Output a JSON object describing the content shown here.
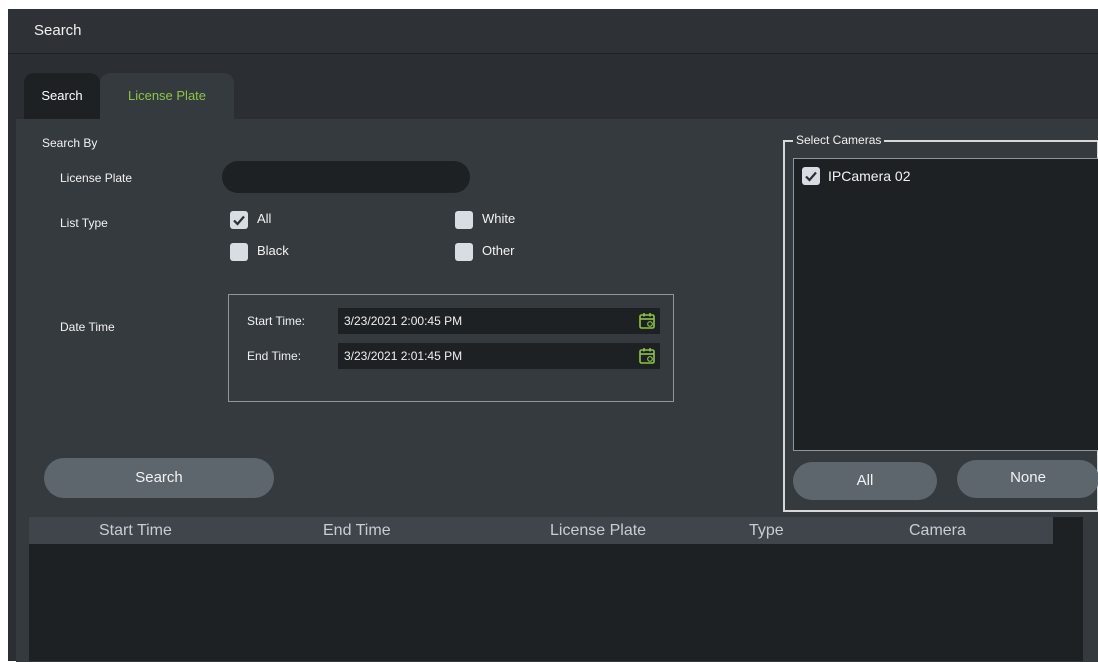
{
  "window": {
    "title": "Search"
  },
  "tabs": [
    {
      "label": "Search"
    },
    {
      "label": "License Plate"
    }
  ],
  "search_by": {
    "heading": "Search By",
    "license_plate_label": "License Plate",
    "license_plate_value": "",
    "list_type_label": "List Type",
    "list_types": [
      {
        "label": "All",
        "checked": true
      },
      {
        "label": "White",
        "checked": false
      },
      {
        "label": "Black",
        "checked": false
      },
      {
        "label": "Other",
        "checked": false
      }
    ],
    "date_time_label": "Date Time",
    "start_time_label": "Start Time:",
    "start_time_value": "3/23/2021 2:00:45 PM",
    "end_time_label": "End Time:",
    "end_time_value": "3/23/2021 2:01:45 PM",
    "search_button": "Search"
  },
  "cameras": {
    "legend": "Select Cameras",
    "items": [
      {
        "label": "IPCamera 02",
        "checked": true
      }
    ],
    "all_button": "All",
    "none_button": "None"
  },
  "results": {
    "columns": [
      "Start Time",
      "End Time",
      "License Plate",
      "Type",
      "Camera"
    ]
  },
  "colors": {
    "accent_green": "#8cc63f",
    "background": "#2b2f33",
    "panel": "#353a3f",
    "field": "#1e2124",
    "button": "#5e666d"
  }
}
